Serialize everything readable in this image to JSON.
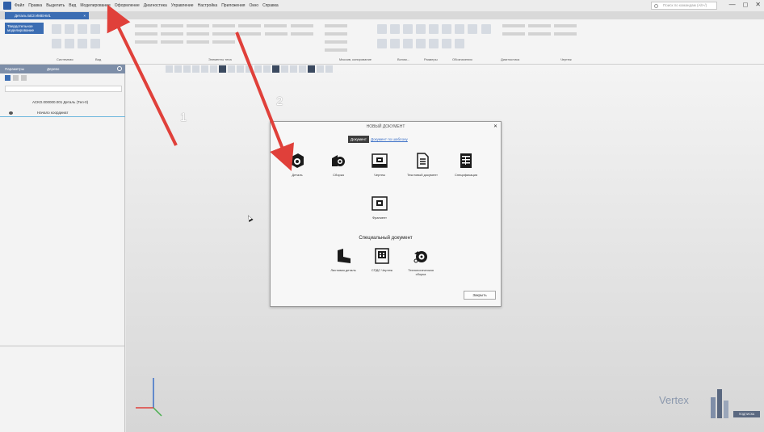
{
  "menu": {
    "items": [
      "Файл",
      "Правка",
      "Выделить",
      "Вид",
      "Моделирование",
      "Оформление",
      "Диагностика",
      "Управление",
      "Настройка",
      "Приложения",
      "Окно",
      "Справка"
    ],
    "search_placeholder": "Поиск по командам (Alt+/)"
  },
  "window_controls": {
    "minimize": "—",
    "maximize": "◻",
    "close": "✕"
  },
  "document_tab": {
    "label": "Деталь БЕЗ ИМЕНИ1",
    "close": "×"
  },
  "ribbon": {
    "model_button": "Твердотельное моделирование",
    "groups": [
      "Системная",
      "Вид",
      "Элементы тела",
      "Массив, копирование",
      "Вспом...",
      "Размеры",
      "Обозначения",
      "Диагностика",
      "Чертеж"
    ]
  },
  "tree_panel": {
    "title": "Параметры",
    "subtitle": "Дерево",
    "items": [
      {
        "label": "АСКО.000000.001 Деталь (Тел-0)"
      },
      {
        "label": "Начало координат"
      }
    ]
  },
  "dialog": {
    "title": "НОВЫЙ ДОКУМЕНТ",
    "tabs": {
      "active": "Документ",
      "link": "Документ по шаблону"
    },
    "documents": [
      {
        "label": "Деталь",
        "icon": "part-icon"
      },
      {
        "label": "Сборка",
        "icon": "assembly-icon"
      },
      {
        "label": "Чертеж",
        "icon": "drawing-icon"
      },
      {
        "label": "Текстовый документ",
        "icon": "text-document-icon"
      },
      {
        "label": "Спецификация",
        "icon": "specification-icon"
      },
      {
        "label": "Фрагмент",
        "icon": "fragment-icon"
      }
    ],
    "special_title": "Специальный документ",
    "special_documents": [
      {
        "label": "Листовая деталь",
        "icon": "sheet-part-icon"
      },
      {
        "label": "СПДС Чертеж",
        "icon": "spds-drawing-icon"
      },
      {
        "label": "Технологическая сборка",
        "icon": "tech-assembly-icon"
      }
    ],
    "close_button": "Закрыть"
  },
  "annotations": {
    "one": "1",
    "two": "2"
  },
  "logo": {
    "text": "Vertex",
    "sub": "ПОДПИСКА"
  },
  "colors": {
    "accent": "#3b6db3",
    "arrow": "#e0403a"
  }
}
